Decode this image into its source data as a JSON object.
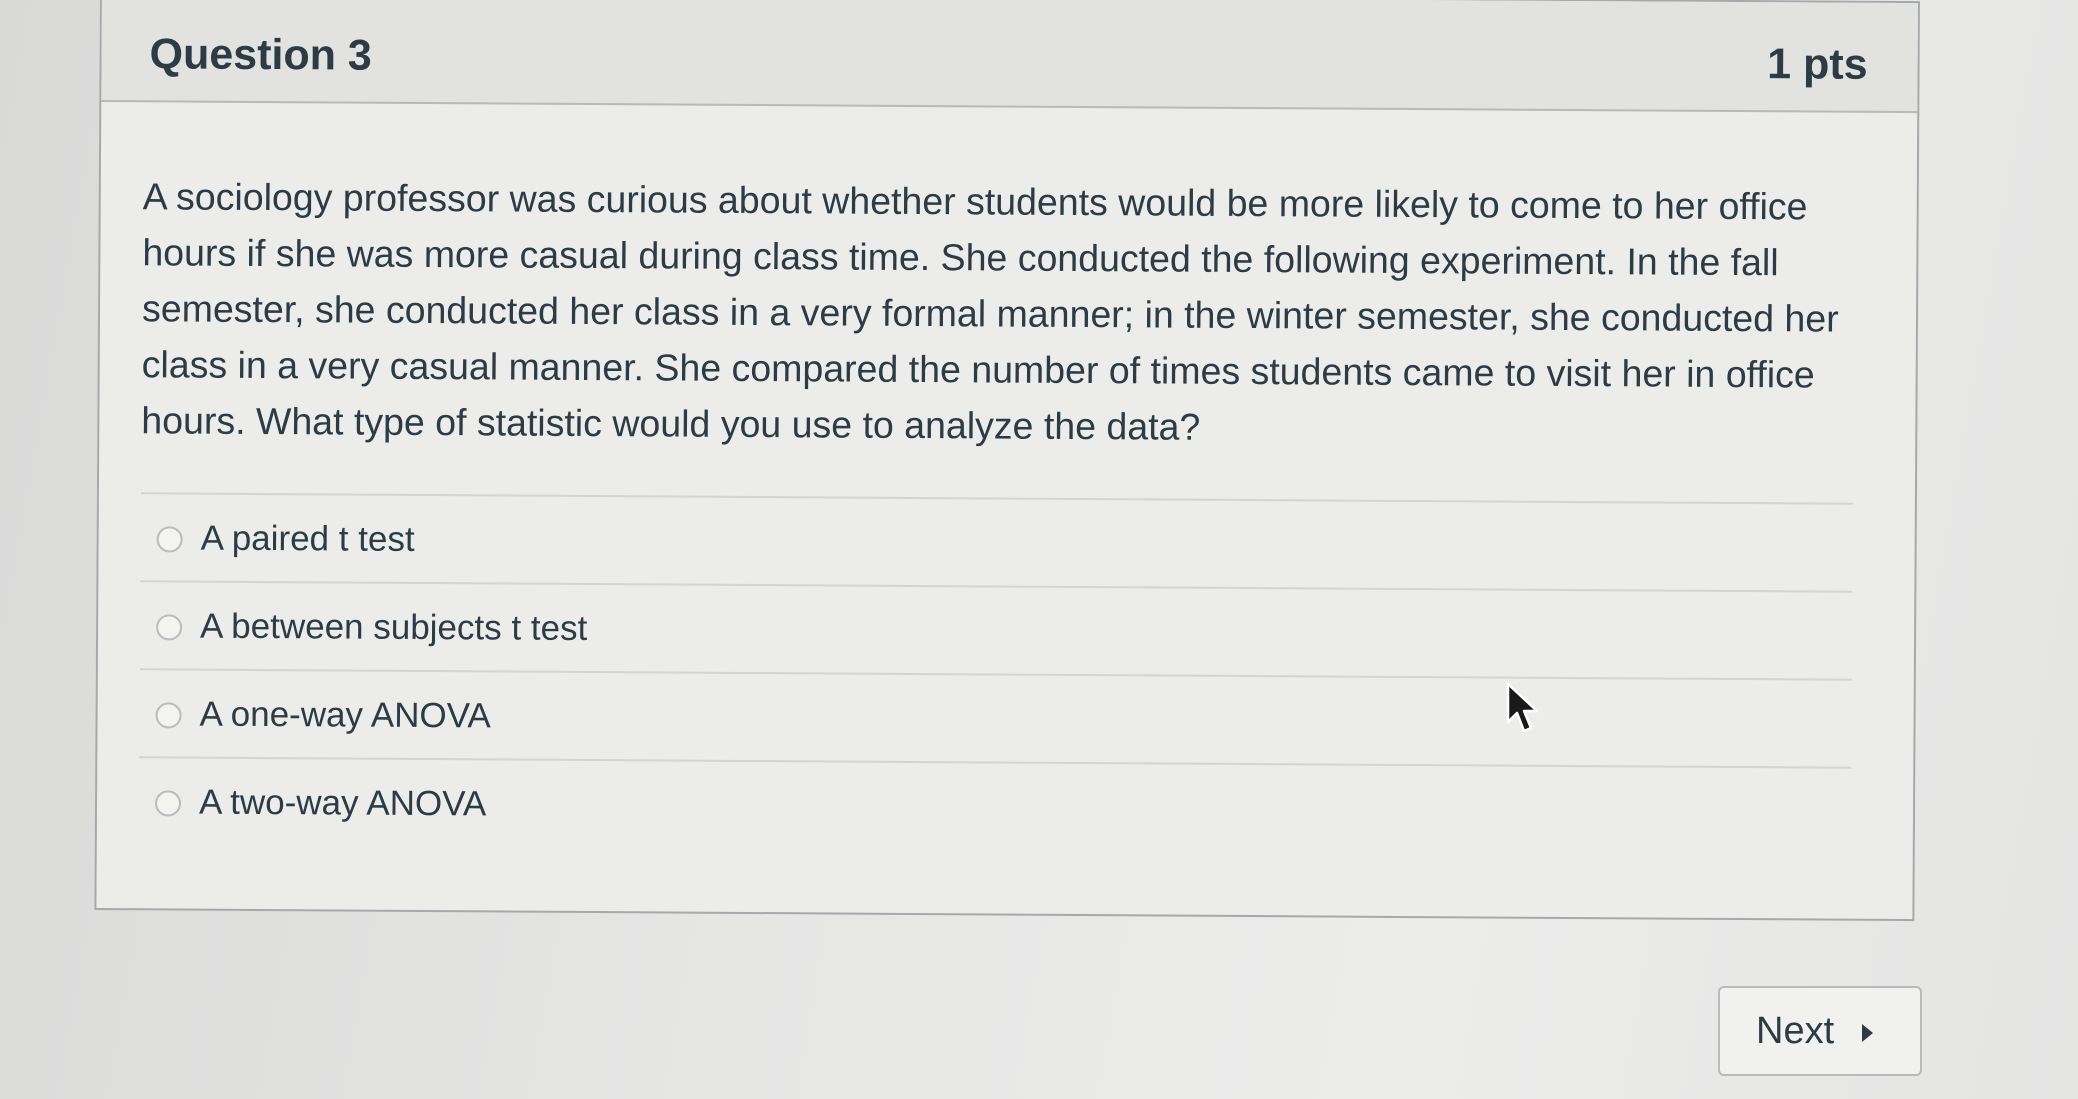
{
  "question": {
    "title": "Question 3",
    "points": "1 pts",
    "text": "A sociology professor was curious about whether students would be more likely to come to her office hours if she was more casual during class time. She conducted the following experiment. In the fall semester, she conducted her class in a very formal manner; in the winter semester, she conducted her class in a very casual manner. She compared the number of times students came to visit her in office hours. What type of statistic would you use to analyze the data?",
    "answers": [
      {
        "label": "A paired t test",
        "selected": false
      },
      {
        "label": "A between subjects t test",
        "selected": false
      },
      {
        "label": "A one-way ANOVA",
        "selected": false
      },
      {
        "label": "A two-way ANOVA",
        "selected": false
      }
    ]
  },
  "navigation": {
    "next_label": "Next",
    "next_icon": "caret-right-icon"
  },
  "cursor": {
    "icon": "mouse-pointer-icon"
  }
}
